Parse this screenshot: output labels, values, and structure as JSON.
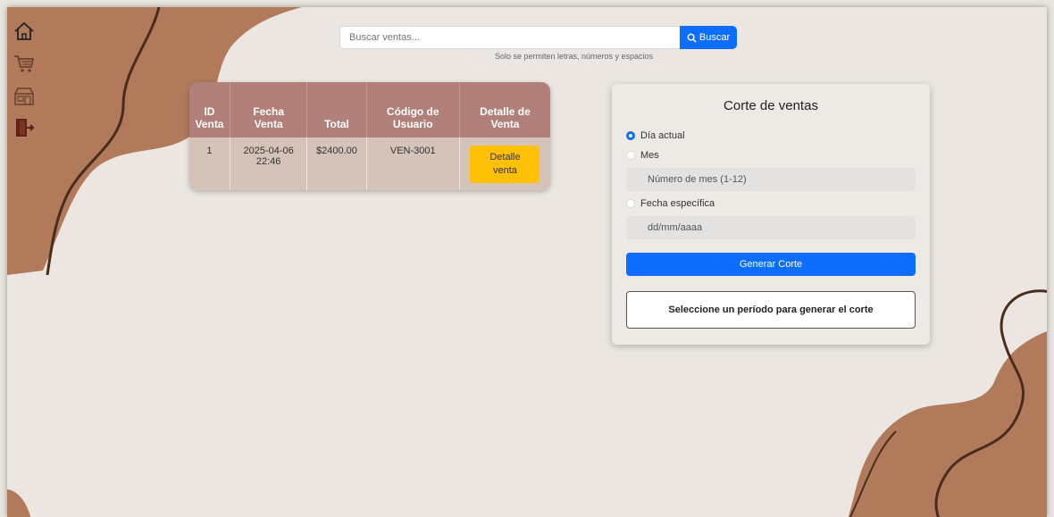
{
  "colors": {
    "accent": "#0d6efd",
    "blob": "#b07a5b",
    "line": "#4a2c1c",
    "header": "#b1807a",
    "row": "#d5c2b8",
    "warn": "#ffc107"
  },
  "sidebar": {
    "icons": [
      "home-icon",
      "cart-icon",
      "store-icon",
      "logout-icon"
    ]
  },
  "search": {
    "placeholder": "Buscar ventas...",
    "button_label": "Buscar",
    "hint": "Solo se permiten letras, números y espacios"
  },
  "table": {
    "headers": [
      {
        "line1": "ID",
        "line2": "Venta"
      },
      {
        "line1": "Fecha",
        "line2": "Venta"
      },
      {
        "line1": "",
        "line2": "Total"
      },
      {
        "line1": "Código de",
        "line2": "Usuario"
      },
      {
        "line1": "Detalle de",
        "line2": "Venta"
      }
    ],
    "rows": [
      {
        "id": "1",
        "fecha_line1": "2025-04-06",
        "fecha_line2": "22:46",
        "total": "$2400.00",
        "usuario": "VEN-3001",
        "detalle_line1": "Detalle",
        "detalle_line2": "venta"
      }
    ]
  },
  "corte": {
    "title": "Corte de ventas",
    "options": {
      "dia": "Día actual",
      "mes": "Mes",
      "fecha": "Fecha específica"
    },
    "mes_placeholder": "Número de mes (1-12)",
    "fecha_placeholder": "dd/mm/aaaa",
    "generate_label": "Generar Corte",
    "message": "Seleccione un período para generar el corte"
  }
}
